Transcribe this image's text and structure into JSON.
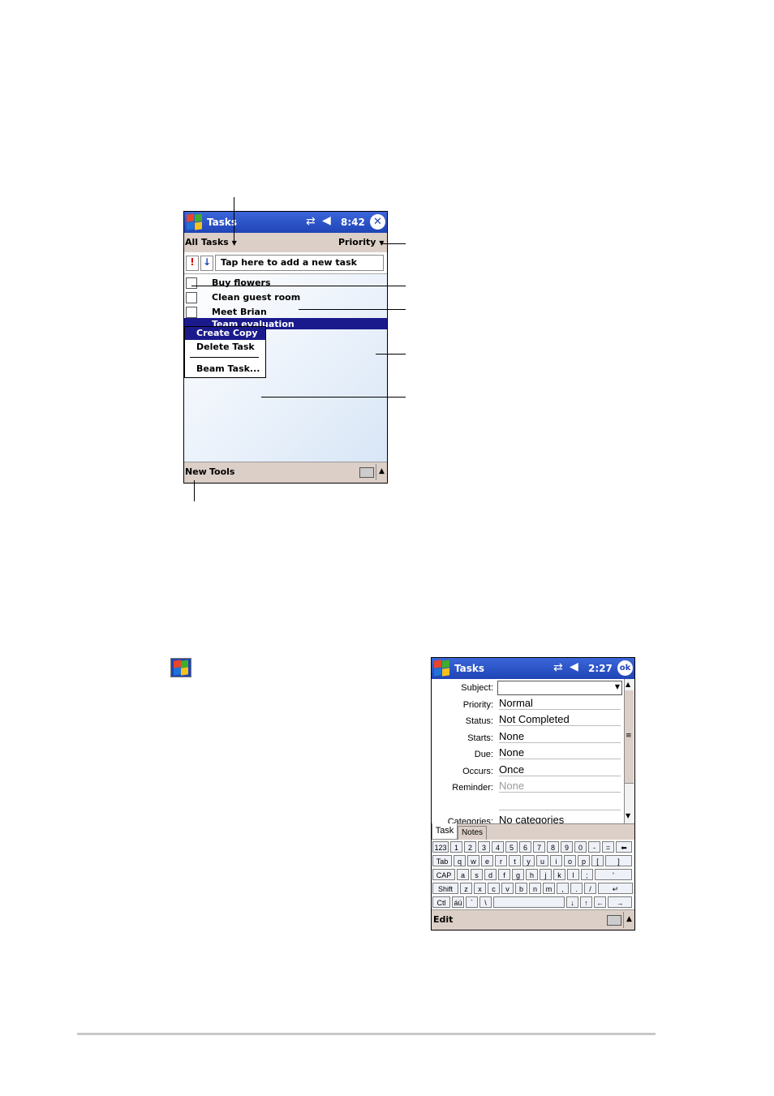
{
  "screen1": {
    "title": "Tasks",
    "time": "8:42",
    "filter": "All Tasks",
    "sort": "Priority",
    "priority_header": "!",
    "sort_arrow": "↓",
    "new_task_placeholder": "Tap here to add a new task",
    "tasks": [
      "Buy flowers",
      "Clean guest room",
      "Meet Brian",
      "Team evaluation"
    ],
    "context_menu": [
      "Create Copy",
      "Delete Task",
      "Beam Task..."
    ],
    "menu_bar": [
      "New",
      "Tools"
    ]
  },
  "screen2": {
    "title": "Tasks",
    "time": "2:27",
    "ok_label": "ok",
    "fields": [
      {
        "label": "Subject:",
        "value": ""
      },
      {
        "label": "Priority:",
        "value": "Normal"
      },
      {
        "label": "Status:",
        "value": "Not Completed"
      },
      {
        "label": "Starts:",
        "value": "None"
      },
      {
        "label": "Due:",
        "value": "None"
      },
      {
        "label": "Occurs:",
        "value": "Once"
      },
      {
        "label": "Reminder:",
        "value": "None"
      },
      {
        "label": "Categories:",
        "value": "No categories"
      }
    ],
    "tabs": [
      "Task",
      "Notes"
    ],
    "menu_bar": [
      "Edit"
    ],
    "keyboard": {
      "row1": [
        "123",
        "1",
        "2",
        "3",
        "4",
        "5",
        "6",
        "7",
        "8",
        "9",
        "0",
        "-",
        "=",
        "⬅"
      ],
      "row2": [
        "Tab",
        "q",
        "w",
        "e",
        "r",
        "t",
        "y",
        "u",
        "i",
        "o",
        "p",
        "[",
        "]"
      ],
      "row3": [
        "CAP",
        "a",
        "s",
        "d",
        "f",
        "g",
        "h",
        "j",
        "k",
        "l",
        ";",
        "'"
      ],
      "row4": [
        "Shift",
        "z",
        "x",
        "c",
        "v",
        "b",
        "n",
        "m",
        ",",
        ".",
        "/",
        "↵"
      ],
      "row5": [
        "Ctl",
        "áü",
        "`",
        "\\",
        "",
        "↓",
        "↑",
        "←",
        "→"
      ]
    }
  },
  "colors": {
    "titlebar": "#2d52c4",
    "menubar": "#dccfc7",
    "selection": "#1a1a8c",
    "list_bg": "#e6eef9"
  }
}
